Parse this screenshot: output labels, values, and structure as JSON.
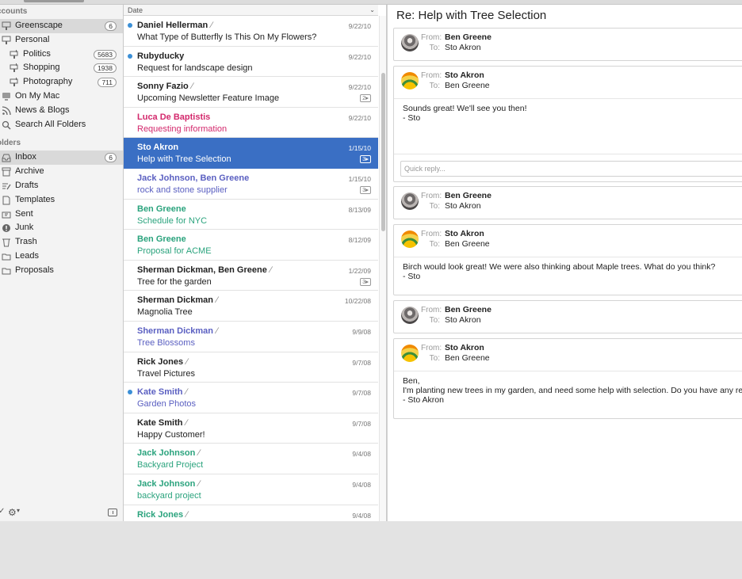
{
  "sidebar": {
    "accounts_header": "ccounts",
    "folders_header": "olders",
    "accounts": [
      {
        "label": "Greenscape",
        "count": "6",
        "icon": "account-icon",
        "level": 0,
        "selected": true
      },
      {
        "label": "Personal",
        "count": "",
        "icon": "account-icon",
        "level": 0
      },
      {
        "label": "Politics",
        "count": "5683",
        "icon": "mailbox-icon",
        "level": 1
      },
      {
        "label": "Shopping",
        "count": "1938",
        "icon": "mailbox-icon",
        "level": 1
      },
      {
        "label": "Photography",
        "count": "711",
        "icon": "mailbox-icon",
        "level": 1
      },
      {
        "label": "On My Mac",
        "count": "",
        "icon": "computer-icon",
        "level": 0
      },
      {
        "label": "News & Blogs",
        "count": "",
        "icon": "rss-icon",
        "level": 0
      },
      {
        "label": "Search All Folders",
        "count": "",
        "icon": "search-icon",
        "level": 0
      }
    ],
    "folders": [
      {
        "label": "Inbox",
        "count": "6",
        "icon": "inbox-icon",
        "selected": true
      },
      {
        "label": "Archive",
        "count": "",
        "icon": "archive-icon"
      },
      {
        "label": "Drafts",
        "count": "",
        "icon": "drafts-icon"
      },
      {
        "label": "Templates",
        "count": "",
        "icon": "templates-icon"
      },
      {
        "label": "Sent",
        "count": "",
        "icon": "sent-icon"
      },
      {
        "label": "Junk",
        "count": "",
        "icon": "junk-icon"
      },
      {
        "label": "Trash",
        "count": "",
        "icon": "trash-icon"
      },
      {
        "label": "Leads",
        "count": "",
        "icon": "folder-icon"
      },
      {
        "label": "Proposals",
        "count": "",
        "icon": "folder-icon"
      }
    ]
  },
  "list": {
    "sort_label": "Date",
    "messages": [
      {
        "from": "Daniel Hellerman",
        "subject": "What Type of Butterfly Is This On My Flowers?",
        "date": "9/22/10",
        "unread": true,
        "attachment": true,
        "thread": "",
        "color": "black"
      },
      {
        "from": "Rubyducky",
        "subject": "Request for landscape design",
        "date": "9/22/10",
        "unread": true,
        "attachment": false,
        "thread": "",
        "color": "black"
      },
      {
        "from": "Sonny Fazio",
        "subject": "Upcoming Newsletter Feature Image",
        "date": "9/22/10",
        "unread": false,
        "attachment": true,
        "thread": "2▸",
        "color": "black"
      },
      {
        "from": "Luca De Baptistis",
        "subject": "Requesting information",
        "date": "9/22/10",
        "unread": false,
        "attachment": false,
        "thread": "",
        "color": "pink"
      },
      {
        "from": "Sto Akron",
        "subject": "Help with Tree Selection",
        "date": "1/15/10",
        "unread": false,
        "attachment": false,
        "thread": "3▸",
        "color": "black",
        "selected": true
      },
      {
        "from": "Jack Johnson, Ben Greene",
        "subject": "rock and stone supplier",
        "date": "1/15/10",
        "unread": false,
        "attachment": false,
        "thread": "3▸",
        "color": "blue"
      },
      {
        "from": "Ben Greene",
        "subject": "Schedule for NYC",
        "date": "8/13/09",
        "unread": false,
        "attachment": false,
        "thread": "",
        "color": "green"
      },
      {
        "from": "Ben Greene",
        "subject": "Proposal for ACME",
        "date": "8/12/09",
        "unread": false,
        "attachment": false,
        "thread": "",
        "color": "green"
      },
      {
        "from": "Sherman Dickman, Ben Greene",
        "subject": "Tree for the garden",
        "date": "1/22/09",
        "unread": false,
        "attachment": true,
        "thread": "3▸",
        "color": "black"
      },
      {
        "from": "Sherman Dickman",
        "subject": "Magnolia Tree",
        "date": "10/22/08",
        "unread": false,
        "attachment": true,
        "thread": "",
        "color": "black"
      },
      {
        "from": "Sherman Dickman",
        "subject": "Tree Blossoms",
        "date": "9/9/08",
        "unread": false,
        "attachment": true,
        "thread": "",
        "color": "blue"
      },
      {
        "from": "Rick Jones",
        "subject": "Travel Pictures",
        "date": "9/7/08",
        "unread": false,
        "attachment": true,
        "thread": "",
        "color": "black"
      },
      {
        "from": "Kate Smith",
        "subject": "Garden Photos",
        "date": "9/7/08",
        "unread": true,
        "attachment": true,
        "thread": "",
        "color": "blue"
      },
      {
        "from": "Kate Smith",
        "subject": "Happy Customer!",
        "date": "9/7/08",
        "unread": false,
        "attachment": true,
        "thread": "",
        "color": "black"
      },
      {
        "from": "Jack Johnson",
        "subject": "Backyard Project",
        "date": "9/4/08",
        "unread": false,
        "attachment": true,
        "thread": "",
        "color": "green"
      },
      {
        "from": "Jack Johnson",
        "subject": "backyard project",
        "date": "9/4/08",
        "unread": false,
        "attachment": true,
        "thread": "",
        "color": "green"
      },
      {
        "from": "Rick Jones",
        "subject": "",
        "date": "9/4/08",
        "unread": false,
        "attachment": true,
        "thread": "",
        "color": "green"
      }
    ]
  },
  "reader": {
    "title": "Re: Help with Tree Selection",
    "from_label": "From:",
    "to_label": "To:",
    "quick_reply_placeholder": "Quick reply...",
    "messages": [
      {
        "from": "Ben Greene",
        "to": "Sto Akron",
        "avatar": "ben",
        "body": [],
        "quick_reply": false
      },
      {
        "from": "Sto Akron",
        "to": "Ben Greene",
        "avatar": "sto",
        "body": [
          "Sounds great!  We'll see you then!",
          "- Sto"
        ],
        "quick_reply": true
      },
      {
        "from": "Ben Greene",
        "to": "Sto Akron",
        "avatar": "ben",
        "body": [],
        "quick_reply": false
      },
      {
        "from": "Sto Akron",
        "to": "Ben Greene",
        "avatar": "sto",
        "body": [
          "Birch would look great!  We were also thinking about Maple trees.  What do you think?",
          "- Sto"
        ],
        "quick_reply": false
      },
      {
        "from": "Ben Greene",
        "to": "Sto Akron",
        "avatar": "ben",
        "body": [],
        "quick_reply": false
      },
      {
        "from": "Sto Akron",
        "to": "Ben Greene",
        "avatar": "sto",
        "body": [
          "Ben,",
          "I'm planting new trees in my garden, and need some help with selection.  Do you have any recomme",
          "- Sto Akron"
        ],
        "quick_reply": false
      }
    ]
  },
  "colors": {
    "selection": "#3a6fc4",
    "unread_dot": "#3b8fd6",
    "pink": "#d3286c",
    "blue": "#5a5fc1",
    "green": "#2aa37d"
  }
}
